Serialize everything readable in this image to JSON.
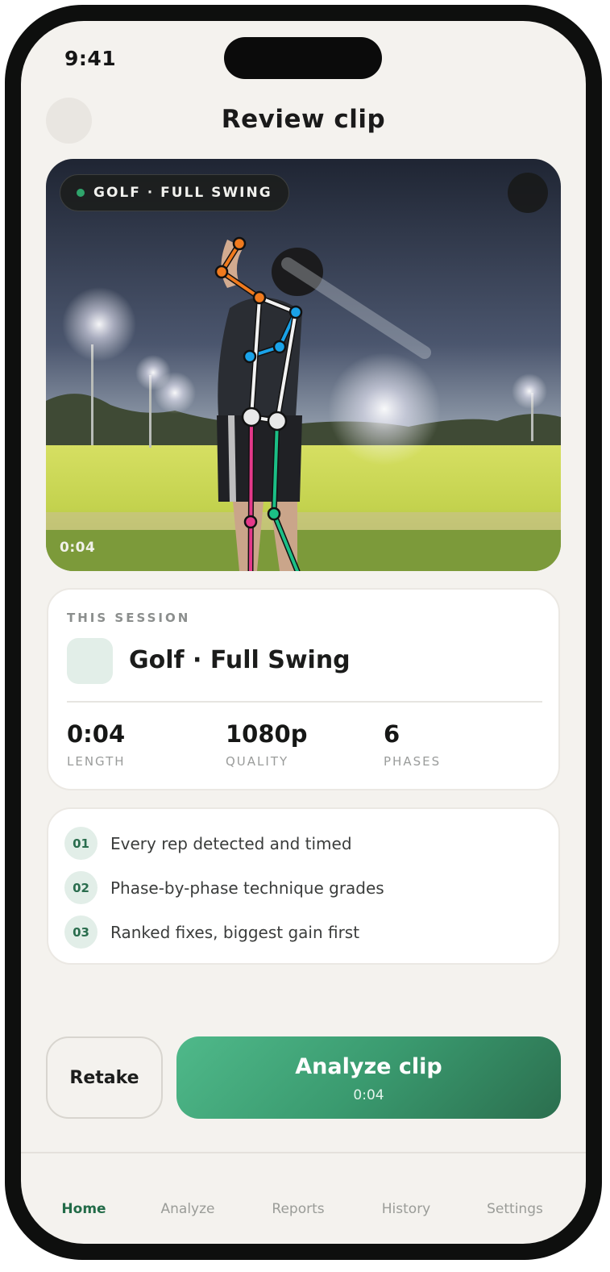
{
  "status_bar": {
    "time": "9:41"
  },
  "header": {
    "title": "Review clip"
  },
  "video": {
    "sport_badge": "GOLF · FULL SWING",
    "timestamp": "0:04"
  },
  "session": {
    "label": "THIS SESSION",
    "name": "Golf · Full Swing",
    "stats": [
      {
        "value": "0:04",
        "label": "LENGTH"
      },
      {
        "value": "1080p",
        "label": "QUALITY"
      },
      {
        "value": "6",
        "label": "PHASES"
      }
    ]
  },
  "steps": [
    {
      "num": "01",
      "text": "Every rep detected and timed"
    },
    {
      "num": "02",
      "text": "Phase-by-phase technique grades"
    },
    {
      "num": "03",
      "text": "Ranked fixes, biggest gain first"
    }
  ],
  "actions": {
    "retake": "Retake",
    "analyze": "Analyze clip",
    "analyze_sub": "0:04"
  },
  "tabs": [
    "Home",
    "Analyze",
    "Reports",
    "History",
    "Settings"
  ],
  "colors": {
    "accent": "#2f9e6b",
    "accent_dark": "#226b48",
    "background": "#f4f2ee"
  }
}
